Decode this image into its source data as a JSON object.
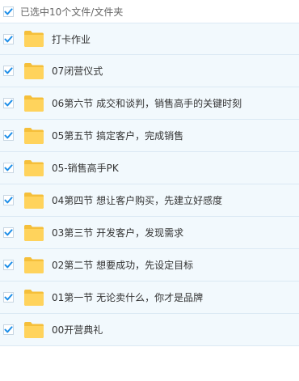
{
  "header": {
    "label": "已选中10个文件/文件夹",
    "checked": true
  },
  "colors": {
    "accent": "#1d8ee8",
    "folder": "#ffd35c",
    "folder_shadow": "#f5bf3a",
    "row_bg": "#f2f9fd",
    "row_border": "#dbe9f4",
    "text": "#333333",
    "header_text": "#666666"
  },
  "files": [
    {
      "name": "打卡作业",
      "type": "folder-icon",
      "checked": true
    },
    {
      "name": "07闭营仪式",
      "type": "folder-icon",
      "checked": true
    },
    {
      "name": "06第六节 成交和谈判，销售高手的关键时刻",
      "type": "folder-icon",
      "checked": true
    },
    {
      "name": "05第五节 搞定客户，完成销售",
      "type": "folder-icon",
      "checked": true
    },
    {
      "name": "05-销售高手PK",
      "type": "folder-icon",
      "checked": true
    },
    {
      "name": "04第四节 想让客户购买，先建立好感度",
      "type": "folder-icon",
      "checked": true
    },
    {
      "name": "03第三节 开发客户，发现需求",
      "type": "folder-icon",
      "checked": true
    },
    {
      "name": "02第二节 想要成功，先设定目标",
      "type": "folder-icon",
      "checked": true
    },
    {
      "name": "01第一节 无论卖什么，你才是品牌",
      "type": "folder-icon",
      "checked": true
    },
    {
      "name": "00开营典礼",
      "type": "folder-icon",
      "checked": true
    }
  ]
}
